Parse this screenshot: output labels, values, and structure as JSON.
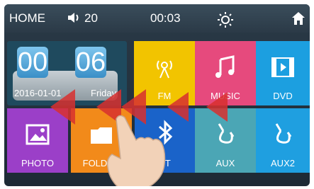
{
  "status_bar": {
    "home_label": "HOME",
    "volume": "20",
    "time": "00:03"
  },
  "clock_widget": {
    "hours": "00",
    "minutes": "06",
    "date": "2016-01-01",
    "weekday": "Friday"
  },
  "tiles": [
    {
      "label": "FM",
      "icon": "radio-antenna-icon",
      "color": "#f2c400"
    },
    {
      "label": "MUSIC",
      "icon": "music-note-icon",
      "color": "#e64a7d"
    },
    {
      "label": "DVD",
      "icon": "film-play-icon",
      "color": "#1c9fe0"
    },
    {
      "label": "PHOTO",
      "icon": "image-icon",
      "color": "#9b3fc8"
    },
    {
      "label": "FOLDER",
      "icon": "folder-icon",
      "color": "#f28a1a"
    },
    {
      "label": "BT",
      "icon": "bluetooth-icon",
      "color": "#1a63c9"
    },
    {
      "label": "AUX",
      "icon": "aux-cable-icon",
      "color": "#4ba6b5"
    },
    {
      "label": "AUX2",
      "icon": "aux-cable-icon",
      "color": "#1f9fe0"
    }
  ],
  "overlay": {
    "gesture": "swipe-left",
    "arrow_color": "#d8302f"
  }
}
